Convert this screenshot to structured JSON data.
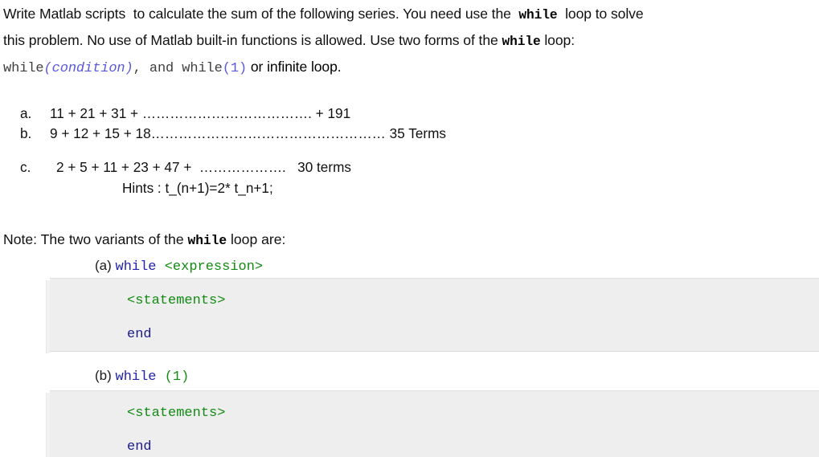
{
  "document": {
    "intro": {
      "line1_part1": "Write Matlab scripts  to calculate the sum of the following series. You need use the  ",
      "line1_code": "while",
      "line1_part2": "  loop to solve",
      "line2_part1": "this problem. No use of Matlab built-in functions is allowed. Use two forms of the ",
      "line2_code": "while",
      "line2_part2": " loop:",
      "line3_kw1": "while",
      "line3_cond": "(condition)",
      "line3_mid": ", and while",
      "line3_one": "(1)",
      "line3_tail": " or infinite loop."
    },
    "series": {
      "items": [
        {
          "marker": "a.",
          "text": "11 + 21 + 31 + ………………………………. + 191"
        },
        {
          "marker": "b.",
          "text": "9 + 12 + 15 + 18…………………………………………… 35 Terms"
        },
        {
          "marker": "c.",
          "text": "2 + 5 + 11 + 23 + 47 +  ……………….   30 terms"
        }
      ],
      "hint": "Hints : t_(n+1)=2* t_n+1;"
    },
    "note": {
      "prefix": "Note: The two variants of the ",
      "code": "while",
      "suffix": " loop are:"
    },
    "variants": [
      {
        "label": "(a) ",
        "keyword": "while",
        "argument": " <expression>",
        "code": {
          "statements": "<statements>",
          "end": "end"
        }
      },
      {
        "label": "(b) ",
        "keyword": "while",
        "argument": " (1)",
        "code": {
          "statements": "<statements>",
          "end": "end"
        }
      }
    ],
    "colors": {
      "keyword_blue": "#2222aa",
      "green": "#138a13",
      "end_blue": "#1a1a8c",
      "violet": "#5a5ad8",
      "mono_gray": "#3f3f3f",
      "code_background": "#eeeeee"
    }
  }
}
